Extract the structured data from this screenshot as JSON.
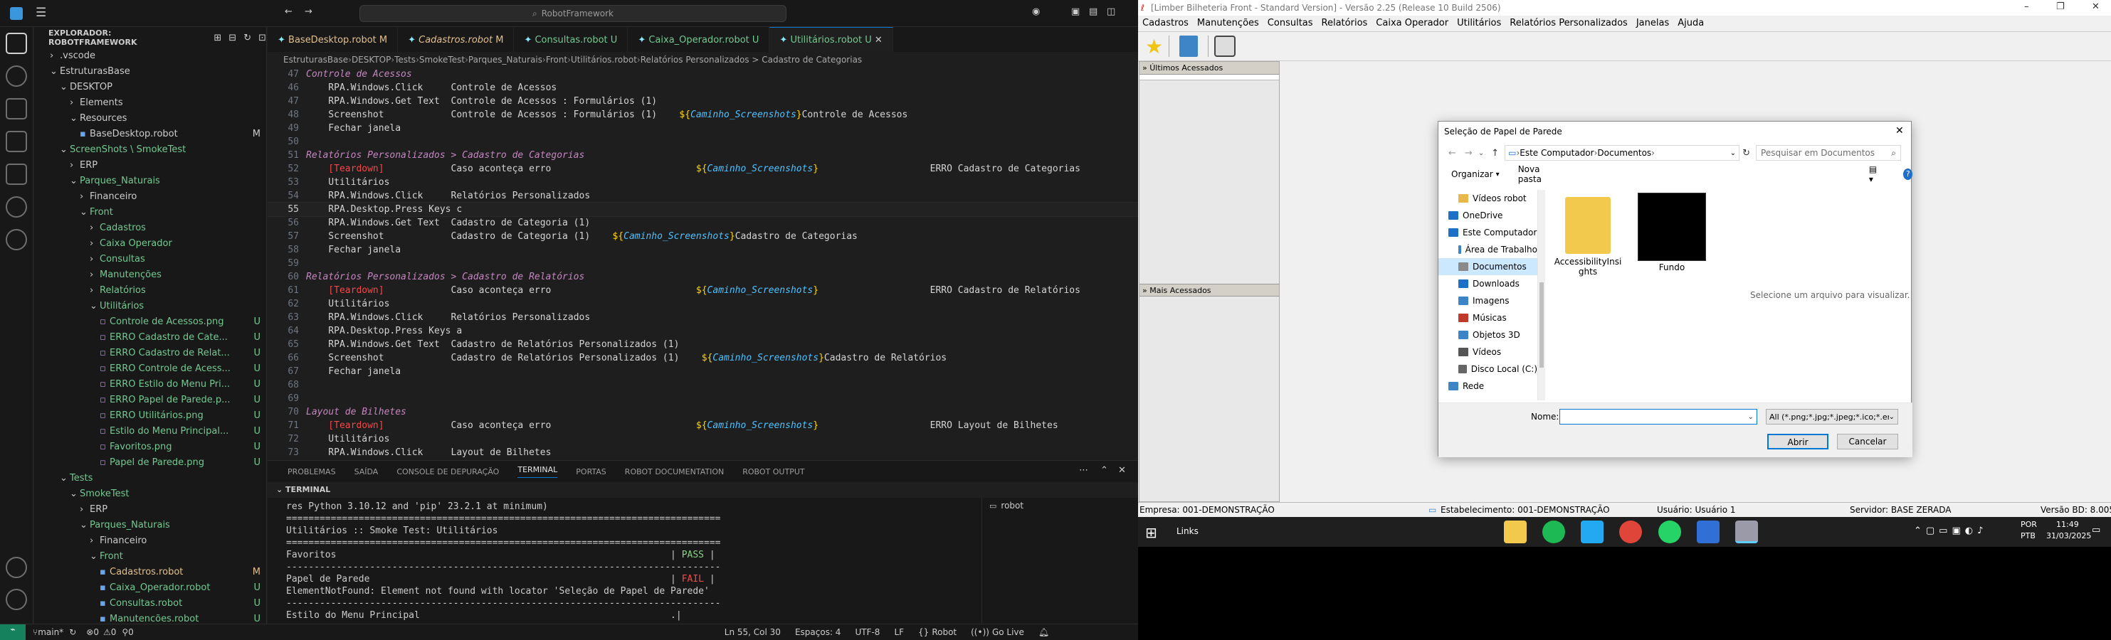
{
  "vscode": {
    "search": "RobotFramework",
    "explorer_title": "EXPLORADOR: ROBOTFRAMEWORK",
    "tree": [
      {
        "label": ".vscode",
        "depth": 1,
        "icon": "chevron-right",
        "color": "#cccccc",
        "status": ""
      },
      {
        "label": "EstruturasBase",
        "depth": 1,
        "icon": "chevron-down",
        "color": "#cccccc",
        "status": ""
      },
      {
        "label": "DESKTOP",
        "depth": 2,
        "icon": "chevron-down",
        "color": "#cccccc",
        "status": ""
      },
      {
        "label": "Elements",
        "depth": 3,
        "icon": "chevron-right",
        "color": "#cccccc",
        "status": ""
      },
      {
        "label": "Resources",
        "depth": 3,
        "icon": "chevron-down",
        "color": "#cccccc",
        "status": ""
      },
      {
        "label": "BaseDesktop.robot",
        "depth": 4,
        "icon": "file",
        "color": "#cccccc",
        "status": "M"
      },
      {
        "label": "ScreenShots \\ SmokeTest",
        "depth": 2,
        "icon": "chevron-down",
        "color": "#73c991",
        "status": ""
      },
      {
        "label": "ERP",
        "depth": 3,
        "icon": "chevron-right",
        "color": "#cccccc",
        "status": ""
      },
      {
        "label": "Parques_Naturais",
        "depth": 3,
        "icon": "chevron-down",
        "color": "#73c991",
        "status": ""
      },
      {
        "label": "Financeiro",
        "depth": 4,
        "icon": "chevron-right",
        "color": "#cccccc",
        "status": ""
      },
      {
        "label": "Front",
        "depth": 4,
        "icon": "chevron-down",
        "color": "#73c991",
        "status": ""
      },
      {
        "label": "Cadastros",
        "depth": 5,
        "icon": "chevron-right",
        "color": "#73c991",
        "status": ""
      },
      {
        "label": "Caixa Operador",
        "depth": 5,
        "icon": "chevron-right",
        "color": "#73c991",
        "status": ""
      },
      {
        "label": "Consultas",
        "depth": 5,
        "icon": "chevron-right",
        "color": "#73c991",
        "status": ""
      },
      {
        "label": "Manutenções",
        "depth": 5,
        "icon": "chevron-right",
        "color": "#73c991",
        "status": ""
      },
      {
        "label": "Relatórios",
        "depth": 5,
        "icon": "chevron-right",
        "color": "#73c991",
        "status": ""
      },
      {
        "label": "Utilitários",
        "depth": 5,
        "icon": "chevron-down",
        "color": "#73c991",
        "status": ""
      },
      {
        "label": "Controle de Acessos.png",
        "depth": 6,
        "icon": "image",
        "color": "#73c991",
        "status": "U"
      },
      {
        "label": "ERRO Cadastro de Cate...",
        "depth": 6,
        "icon": "image",
        "color": "#73c991",
        "status": "U"
      },
      {
        "label": "ERRO Cadastro de Relat...",
        "depth": 6,
        "icon": "image",
        "color": "#73c991",
        "status": "U"
      },
      {
        "label": "ERRO Controle de Acess...",
        "depth": 6,
        "icon": "image",
        "color": "#73c991",
        "status": "U"
      },
      {
        "label": "ERRO Estilo do Menu Pri...",
        "depth": 6,
        "icon": "image",
        "color": "#73c991",
        "status": "U"
      },
      {
        "label": "ERRO Papel de Parede.p...",
        "depth": 6,
        "icon": "image",
        "color": "#73c991",
        "status": "U"
      },
      {
        "label": "ERRO Utilitários.png",
        "depth": 6,
        "icon": "image",
        "color": "#73c991",
        "status": "U"
      },
      {
        "label": "Estilo do Menu Principal...",
        "depth": 6,
        "icon": "image",
        "color": "#73c991",
        "status": "U"
      },
      {
        "label": "Favoritos.png",
        "depth": 6,
        "icon": "image",
        "color": "#73c991",
        "status": "U"
      },
      {
        "label": "Papel de Parede.png",
        "depth": 6,
        "icon": "image",
        "color": "#73c991",
        "status": "U"
      },
      {
        "label": "Tests",
        "depth": 2,
        "icon": "chevron-down",
        "color": "#73c991",
        "status": ""
      },
      {
        "label": "SmokeTest",
        "depth": 3,
        "icon": "chevron-down",
        "color": "#73c991",
        "status": ""
      },
      {
        "label": "ERP",
        "depth": 4,
        "icon": "chevron-right",
        "color": "#cccccc",
        "status": ""
      },
      {
        "label": "Parques_Naturais",
        "depth": 4,
        "icon": "chevron-down",
        "color": "#73c991",
        "status": ""
      },
      {
        "label": "Financeiro",
        "depth": 5,
        "icon": "chevron-right",
        "color": "#cccccc",
        "status": ""
      },
      {
        "label": "Front",
        "depth": 5,
        "icon": "chevron-down",
        "color": "#73c991",
        "status": ""
      },
      {
        "label": "Cadastros.robot",
        "depth": 6,
        "icon": "file",
        "color": "#e2c08d",
        "status": "M"
      },
      {
        "label": "Caixa_Operador.robot",
        "depth": 6,
        "icon": "file",
        "color": "#73c991",
        "status": "U"
      },
      {
        "label": "Consultas.robot",
        "depth": 6,
        "icon": "file",
        "color": "#73c991",
        "status": "U"
      },
      {
        "label": "Manutencões.robot",
        "depth": 6,
        "icon": "file",
        "color": "#73c991",
        "status": "U"
      }
    ],
    "tabs": [
      {
        "label": "BaseDesktop.robot",
        "status": "M",
        "color": "#e2c08d",
        "active": false
      },
      {
        "label": "Cadastros.robot",
        "status": "M",
        "color": "#e2c08d",
        "active": false
      },
      {
        "label": "Consultas.robot",
        "status": "U",
        "color": "#73c991",
        "active": false
      },
      {
        "label": "Caixa_Operador.robot",
        "status": "U",
        "color": "#73c991",
        "active": false
      },
      {
        "label": "Utilitários.robot",
        "status": "U",
        "color": "#73c991",
        "active": true
      }
    ],
    "breadcrumb": [
      "EstruturasBase",
      "DESKTOP",
      "Tests",
      "SmokeTest",
      "Parques_Naturais",
      "Front",
      "Utilitários.robot",
      "Relatórios Personalizados > Cadastro de Categorias"
    ],
    "code_lines": [
      {
        "n": "47",
        "t": "Controle de Acessos",
        "k": "heading",
        "d": 0
      },
      {
        "n": "46",
        "t": "RPA.Windows.Click",
        "a": "Controle de Acessos",
        "d": 1
      },
      {
        "n": "47",
        "t": "RPA.Windows.Get Text",
        "a": "Controle de Acessos : Formulários (1)",
        "d": 1
      },
      {
        "n": "48",
        "t": "Screenshot",
        "a": "Controle de Acessos : Formulários (1)",
        "v": "${Caminho_Screenshots}",
        "a2": "Controle de Acessos",
        "d": 1
      },
      {
        "n": "49",
        "t": "Fechar janela",
        "d": 1
      },
      {
        "n": "50",
        "t": "",
        "d": 0
      },
      {
        "n": "51",
        "t": "Relatórios Personalizados > Cadastro de Categorias",
        "k": "heading",
        "d": 0
      },
      {
        "n": "52",
        "t": "[Teardown]",
        "a": "Caso aconteça erro",
        "v": "${Caminho_Screenshots}",
        "e": "ERRO Cadastro de Categorias",
        "k": "setting",
        "d": 1
      },
      {
        "n": "53",
        "t": "Utilitários",
        "d": 1
      },
      {
        "n": "54",
        "t": "RPA.Windows.Click",
        "a": "Relatórios Personalizados",
        "d": 1
      },
      {
        "n": "55",
        "t": "RPA.Desktop.Press Keys",
        "a": "c",
        "d": 1,
        "cur": true
      },
      {
        "n": "56",
        "t": "RPA.Windows.Get Text",
        "a": "Cadastro de Categoria (1)",
        "d": 1
      },
      {
        "n": "57",
        "t": "Screenshot",
        "a": "Cadastro de Categoria (1)",
        "v": "${Caminho_Screenshots}",
        "a2": "Cadastro de Categorias",
        "d": 1
      },
      {
        "n": "58",
        "t": "Fechar janela",
        "d": 1
      },
      {
        "n": "59",
        "t": "",
        "d": 0
      },
      {
        "n": "60",
        "t": "Relatórios Personalizados > Cadastro de Relatórios",
        "k": "heading",
        "d": 0
      },
      {
        "n": "61",
        "t": "[Teardown]",
        "a": "Caso aconteça erro",
        "v": "${Caminho_Screenshots}",
        "e": "ERRO Cadastro de Relatórios",
        "k": "setting",
        "d": 1
      },
      {
        "n": "62",
        "t": "Utilitários",
        "d": 1
      },
      {
        "n": "63",
        "t": "RPA.Windows.Click",
        "a": "Relatórios Personalizados",
        "d": 1
      },
      {
        "n": "64",
        "t": "RPA.Desktop.Press Keys",
        "a": "a",
        "d": 1
      },
      {
        "n": "65",
        "t": "RPA.Windows.Get Text",
        "a": "Cadastro de Relatórios Personalizados (1)",
        "d": 1
      },
      {
        "n": "66",
        "t": "Screenshot",
        "a": "Cadastro de Relatórios Personalizados (1)",
        "v": "${Caminho_Screenshots}",
        "a2": "Cadastro de Relatórios",
        "d": 1
      },
      {
        "n": "67",
        "t": "Fechar janela",
        "d": 1
      },
      {
        "n": "68",
        "t": "",
        "d": 0
      },
      {
        "n": "69",
        "t": "",
        "d": 0
      },
      {
        "n": "70",
        "t": "Layout de Bilhetes",
        "k": "heading",
        "d": 0
      },
      {
        "n": "71",
        "t": "[Teardown]",
        "a": "Caso aconteça erro",
        "v": "${Caminho_Screenshots}",
        "e": "ERRO Layout de Bilhetes",
        "k": "setting",
        "d": 1
      },
      {
        "n": "72",
        "t": "Utilitários",
        "d": 1
      },
      {
        "n": "73",
        "t": "RPA.Windows.Click",
        "a": "Layout de Bilhetes",
        "d": 1
      }
    ],
    "panel_tabs": [
      "PROBLEMAS",
      "SAÍDA",
      "CONSOLE DE DEPURAÇÃO",
      "TERMINAL",
      "PORTAS",
      "ROBOT DOCUMENTATION",
      "ROBOT OUTPUT"
    ],
    "panel_active": "TERMINAL",
    "terminal_header": "TERMINAL",
    "terminal_lines": [
      {
        "t": "res Python 3.10.12 and 'pip' 23.2.1 at minimum)"
      },
      {
        "t": "=============================================================================="
      },
      {
        "t": "Utilitários :: Smoke Test: Utilitários"
      },
      {
        "t": "=============================================================================="
      },
      {
        "t": "Favoritos                                                            | ",
        "s": "PASS",
        "sc": "#89d185",
        "end": " |"
      },
      {
        "t": "------------------------------------------------------------------------------"
      },
      {
        "t": "Papel de Parede                                                      | ",
        "s": "FAIL",
        "sc": "#f14c4c",
        "end": " |"
      },
      {
        "t": "ElementNotFound: Element not found with locator 'Seleção de Papel de Parede'"
      },
      {
        "t": "------------------------------------------------------------------------------"
      },
      {
        "t": "Estilo do Menu Principal                                             .|"
      }
    ],
    "terminal_instance": "robot",
    "statusbar": {
      "branch": "main*",
      "problems": "0",
      "warnings": "0",
      "ports": "0",
      "position": "Ln 55, Col 30",
      "spaces": "Espaços: 4",
      "encoding": "UTF-8",
      "eol": "LF",
      "language": "Robot",
      "golive": "Go Live"
    }
  },
  "app": {
    "title": "[Limber Bilheteria Front - Standard Version] - Versão 2.25 (Release 10 Build 2506)",
    "menu": [
      "Cadastros",
      "Manutenções",
      "Consultas",
      "Relatórios",
      "Caixa Operador",
      "Utilitários",
      "Relatórios Personalizados",
      "Janelas",
      "Ajuda"
    ],
    "recent_header": "Últimos Acessados",
    "most_header": "Mais Acessados",
    "status": {
      "empresa": "Empresa: 001-DEMONSTRAÇÃO",
      "estabelecimento": "Estabelecimento: 001-DEMONSTRAÇÃO",
      "usuario": "Usuário: Usuário 1",
      "servidor": "Servidor: BASE ZERADA",
      "versao": "Versão BD: 8.005"
    }
  },
  "dialog": {
    "title": "Seleção de Papel de Parede",
    "path": [
      "Este Computador",
      "Documentos"
    ],
    "search_placeholder": "Pesquisar em Documentos",
    "organize": "Organizar",
    "new_folder": "Nova pasta",
    "nav": [
      {
        "label": "Vídeos robot",
        "kind": "folder",
        "indent": 1
      },
      {
        "label": "OneDrive",
        "kind": "cloud",
        "indent": 0
      },
      {
        "label": "Este Computador",
        "kind": "pc",
        "indent": 0
      },
      {
        "label": "Área de Trabalho",
        "kind": "desktop",
        "indent": 1
      },
      {
        "label": "Documentos",
        "kind": "docs",
        "indent": 1,
        "selected": true
      },
      {
        "label": "Downloads",
        "kind": "download",
        "indent": 1
      },
      {
        "label": "Imagens",
        "kind": "images",
        "indent": 1
      },
      {
        "label": "Músicas",
        "kind": "music",
        "indent": 1
      },
      {
        "label": "Objetos 3D",
        "kind": "objects",
        "indent": 1
      },
      {
        "label": "Vídeos",
        "kind": "videos",
        "indent": 1
      },
      {
        "label": "Disco Local (C:)",
        "kind": "disk",
        "indent": 1
      },
      {
        "label": "Rede",
        "kind": "network",
        "indent": 0
      }
    ],
    "files": [
      {
        "label": "AccessibilityInsights",
        "kind": "folder"
      },
      {
        "label": "Fundo",
        "kind": "image"
      }
    ],
    "preview": "Selecione um arquivo para visualizar.",
    "name_label": "Nome:",
    "name_value": "",
    "filter": "All (*.png;*.jpg;*.jpeg;*.ico;*.en",
    "open": "Abrir",
    "cancel": "Cancelar"
  },
  "taskbar": {
    "links": "Links",
    "lang1": "POR",
    "lang2": "PTB",
    "time": "11:49",
    "date": "31/03/2025"
  },
  "colors": {
    "vs_bg": "#1e1e1e",
    "vs_side": "#181818",
    "vs_blue": "#007acc",
    "accent": "#0078d4",
    "taskbar": "#1f1f1f",
    "win_bg": "#f0f0f0"
  }
}
